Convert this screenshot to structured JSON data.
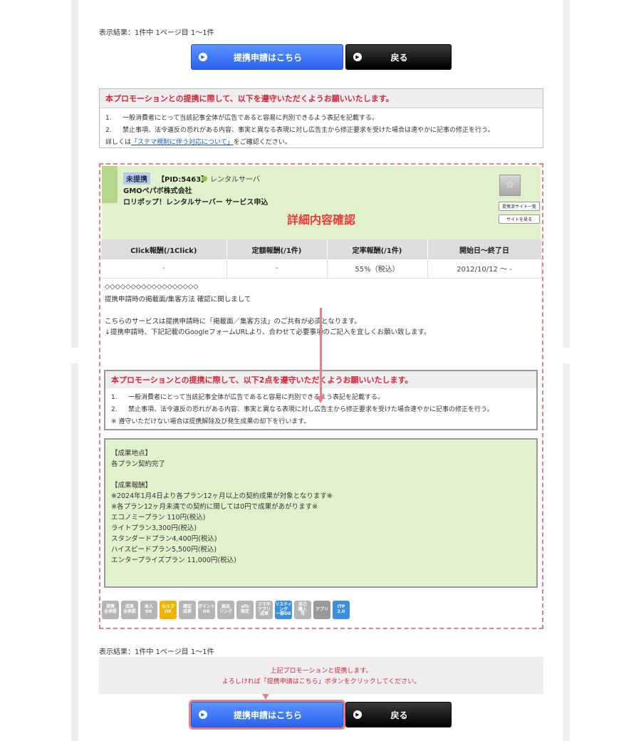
{
  "result_text_top": "表示結果：1件中 1ページ目 1〜1件",
  "result_text_bottom": "表示結果：1件中 1ページ目 1〜1件",
  "buttons": {
    "apply_label": "提携申請はこちら",
    "back_label": "戻る"
  },
  "notice_top": {
    "title": "本プロモーションとの提携に際して、以下を遵守いただくようお願いいたします。",
    "items": [
      {
        "num": "1.",
        "text": "一般消費者にとって当該記事全体が広告であると容易に判別できるよう表記を記載する。"
      },
      {
        "num": "2.",
        "text": "禁止事項、法令違反の恐れがある内容、事実と異なる表現に対し広告主から修正要求を受けた場合は速やかに記事の修正を行う。"
      }
    ],
    "detail_prefix": "詳しくは",
    "detail_link": "「ステマ規制に伴う対応について」",
    "detail_suffix": "をご確認ください。"
  },
  "promotion": {
    "status": "未提携",
    "pid": "【PID:5463】",
    "category": "レンタルサーバ",
    "company": "GMOペパボ株式会社",
    "name": "ロリポップ！レンタルサーバー サービス申込",
    "detail_title": "詳細内容確認",
    "star_icon": "star-icon",
    "side_buttons": [
      "提携済サイト一覧",
      "サイトを見る"
    ]
  },
  "reward_table": {
    "headers": [
      "Click報酬(/1Click)",
      "定額報酬(/1件)",
      "定率報酬(/1件)",
      "開始日〜終了日"
    ],
    "row": [
      "-",
      "-",
      "55%（税込）",
      "2012/10/12 〜 -"
    ]
  },
  "description": {
    "separator": "◇◇◇◇◇◇◇◇◇◇◇◇◇◇◇◇◇◇",
    "line1": "提携申請時の掲載面/集客方法 確認に関しまして",
    "line2": "こちらのサービスは提携申請時に「掲載面／集客方法」のご共有が必須となります。",
    "line3": "↓提携申請時、下記記載のGoogleフォームURLより、合わせて必要事項のご記入を宜しくお願い致します。"
  },
  "notice_inner": {
    "title": "本プロモーションとの提携に際して、以下2点を遵守いただくようお願いいたします。",
    "items": [
      {
        "num": "1.",
        "text": "一般消費者にとって当該記事全体が広告であると容易に判別できるよう表記を記載する。"
      },
      {
        "num": "2.",
        "text": "禁止事項、法令違反の恐れがある内容、事実と異なる表現に対し広告主から修正要求を受けた場合速やかに記事の修正を行う。"
      }
    ],
    "note": "※ 遵守いただけない場合は提携解除及び発生成果の却下を行います。"
  },
  "conditions": {
    "lines": [
      "【成果地点】",
      "各プラン契約完了",
      "",
      "【成果報酬】",
      "※2024年1月4日より各プラン12ヶ月以上の契約成果が対象となります※",
      "※各プラン12ヶ月未満での契約に関しては0円で成果があがります※",
      "エコノミープラン 110円(税込)",
      "ライトプラン3,300円(税込)",
      "スタンダードプラン4,400円(税込)",
      "ハイスピードプラン5,500円(税込)",
      "エンタープライズプラン 11,000円(税込)"
    ]
  },
  "badges": [
    {
      "text": "提携\n全承認",
      "style": "gray"
    },
    {
      "text": "成果\n全承認",
      "style": "gray"
    },
    {
      "text": "本人\nOK",
      "style": "gray"
    },
    {
      "text": "セルフ\nOK",
      "style": "orange"
    },
    {
      "text": "確定\n成果",
      "style": "gray"
    },
    {
      "text": "ポイント\nOK",
      "style": "gray"
    },
    {
      "text": "商品\nリンク",
      "style": "gray"
    },
    {
      "text": "afb\n限定",
      "style": "gray"
    },
    {
      "text": "スマホ\nアプリ\n成果",
      "style": "gray"
    },
    {
      "text": "リスティ\nング\n一部OK",
      "style": "blue"
    },
    {
      "text": "自己\n購入\n可",
      "style": "gray"
    },
    {
      "text": "アプリ",
      "style": "dark"
    },
    {
      "text": "ITP\n2.0",
      "style": "blue"
    }
  ],
  "bottom_notice": {
    "line1": "上記プロモーションと提携します。",
    "line2": "よろしければ「提携申請はこちら」ボタンをクリックしてください。"
  },
  "colors": {
    "accent_red": "#d6263a",
    "annotation_pink": "#ec7f86",
    "header_green": "#e0f1cb",
    "apply_blue": "#2b63f0"
  }
}
